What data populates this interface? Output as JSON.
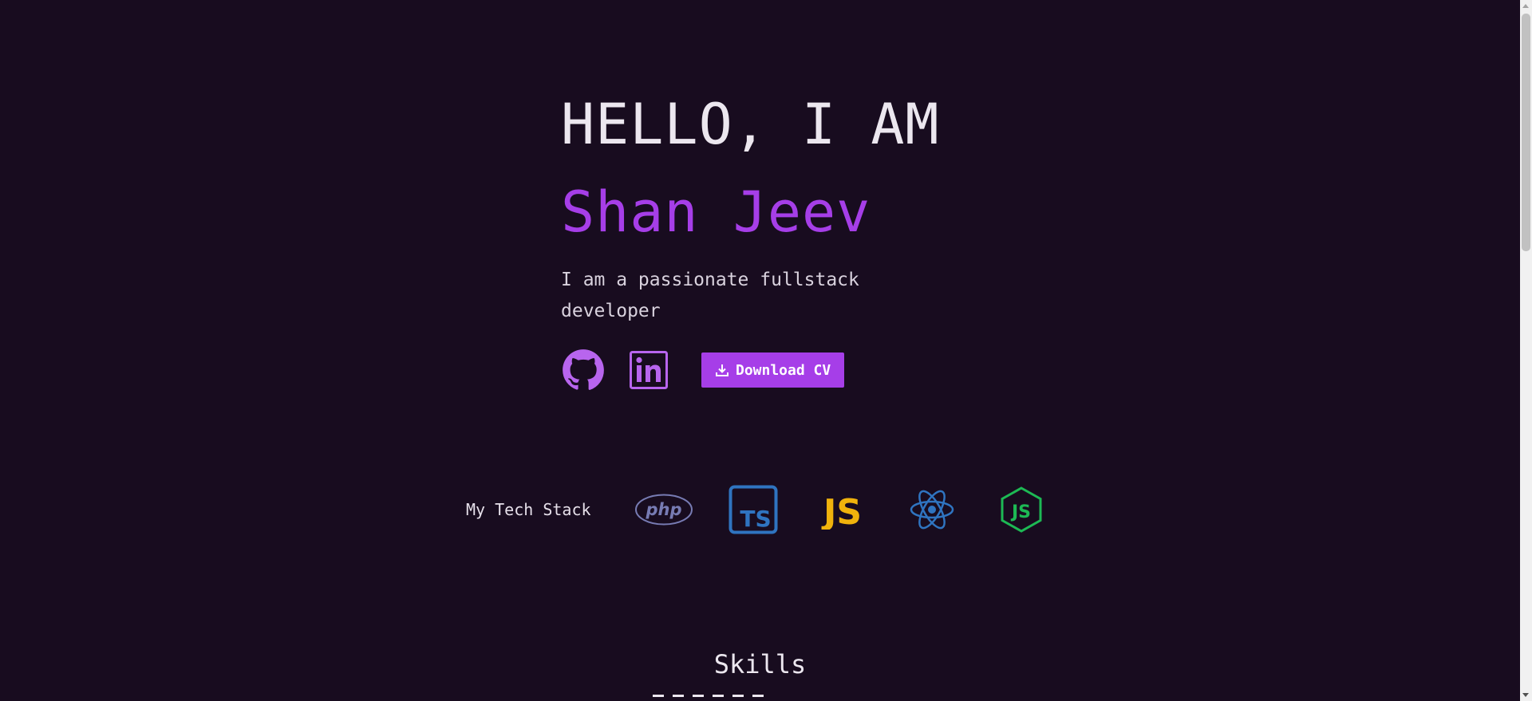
{
  "hero": {
    "greeting": "HELLO, I AM",
    "name": "Shan Jeev",
    "tagline": "I am a passionate fullstack developer"
  },
  "socials": [
    {
      "icon": "github-icon"
    },
    {
      "icon": "linkedin-icon"
    }
  ],
  "cv_button": {
    "label": "Download CV",
    "icon": "download-icon"
  },
  "tech_stack": {
    "label": "My Tech Stack",
    "items": [
      {
        "icon": "php-icon",
        "text": "php",
        "color": "#777bb3"
      },
      {
        "icon": "typescript-icon",
        "text": "TS",
        "color": "#2f74c0"
      },
      {
        "icon": "javascript-icon",
        "text": "JS",
        "color": "#f0b30c"
      },
      {
        "icon": "react-icon",
        "color": "#2f74c0"
      },
      {
        "icon": "nodejs-icon",
        "text": "JS",
        "color": "#1db954"
      }
    ]
  },
  "skills": {
    "title": "Skills"
  },
  "colors": {
    "background": "#180c1f",
    "accent": "#a63ee8",
    "text": "#ece7ef"
  }
}
